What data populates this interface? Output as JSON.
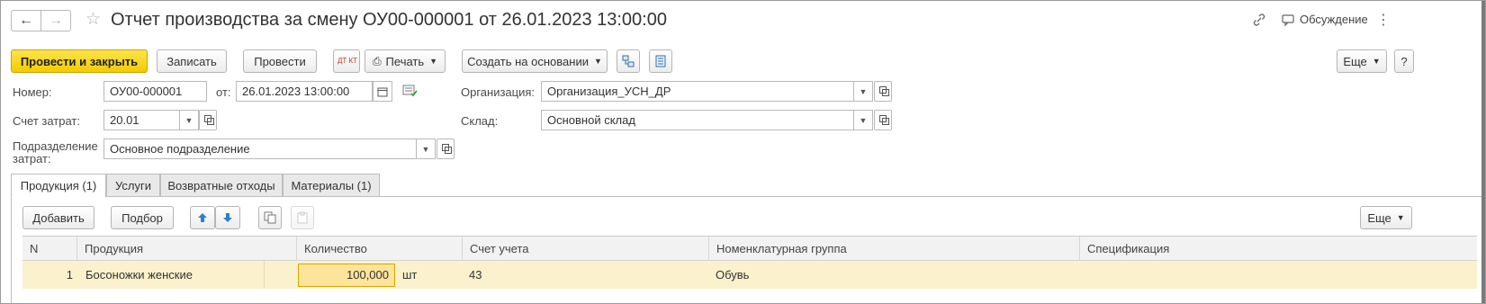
{
  "header": {
    "title": "Отчет производства за смену ОУ00-000001 от 26.01.2023 13:00:00",
    "discussion_label": "Обсуждение"
  },
  "toolbar": {
    "post_close": "Провести и закрыть",
    "save": "Записать",
    "post": "Провести",
    "dt_kt": "ДТ КТ",
    "print": "Печать",
    "create_based": "Создать на основании",
    "more": "Еще",
    "help": "?"
  },
  "form": {
    "number_label": "Номер:",
    "number_value": "ОУ00-000001",
    "from_label": "от:",
    "date_value": "26.01.2023 13:00:00",
    "org_label": "Организация:",
    "org_value": "Организация_УСН_ДР",
    "cost_account_label": "Счет затрат:",
    "cost_account_value": "20.01",
    "warehouse_label": "Склад:",
    "warehouse_value": "Основной склад",
    "division_label_1": "Подразделение",
    "division_label_2": "затрат:",
    "division_value": "Основное подразделение"
  },
  "tabs": [
    {
      "label": "Продукция (1)",
      "active": true
    },
    {
      "label": "Услуги",
      "active": false
    },
    {
      "label": "Возвратные отходы",
      "active": false
    },
    {
      "label": "Материалы (1)",
      "active": false
    }
  ],
  "table_toolbar": {
    "add": "Добавить",
    "select": "Подбор",
    "more": "Еще"
  },
  "table": {
    "columns": [
      "N",
      "Продукция",
      "Количество",
      "Счет учета",
      "Номенклатурная группа",
      "Спецификация"
    ],
    "rows": [
      {
        "n": "1",
        "product": "Босоножки женские",
        "qty": "100,000",
        "unit": "шт",
        "account": "43",
        "group": "Обувь",
        "spec": ""
      }
    ]
  },
  "colors": {
    "primary_button": "#f3cc00",
    "row_highlight": "#fbf1cc",
    "qty_cell": "#fde49b",
    "arrow_blue": "#2f7fd0"
  }
}
